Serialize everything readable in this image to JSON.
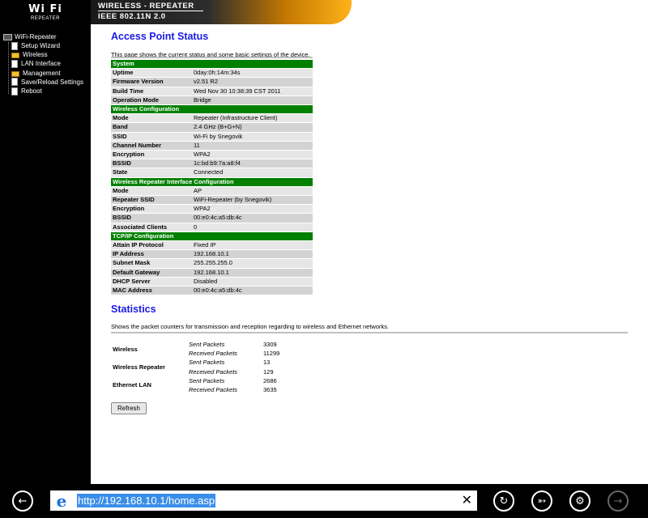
{
  "header": {
    "logo_main": "Wi Fi",
    "logo_sub": "REPEATER",
    "banner_line1": "WIRELESS - REPEATER",
    "banner_line2": "IEEE 802.11N 2.0"
  },
  "sidebar": {
    "root": "WiFi-Repeater",
    "items": [
      {
        "label": "Setup Wizard",
        "icon": "page-icon"
      },
      {
        "label": "Wireless",
        "icon": "folder-icon"
      },
      {
        "label": "LAN Interface",
        "icon": "page-icon"
      },
      {
        "label": "Management",
        "icon": "folder-icon"
      },
      {
        "label": "Save/Reload Settings",
        "icon": "page-icon"
      },
      {
        "label": "Reboot",
        "icon": "page-icon"
      }
    ]
  },
  "main": {
    "title": "Access Point Status",
    "description": "This page shows the current status and some basic settings of the device.",
    "sections": [
      {
        "title": "System",
        "rows": [
          [
            "Uptime",
            "0day:0h:14m:34s"
          ],
          [
            "Firmware Version",
            "v2.51 R2"
          ],
          [
            "Build Time",
            "Wed Nov 30 10:38:39 CST 2011"
          ],
          [
            "Operation Mode",
            "Bridge"
          ]
        ]
      },
      {
        "title": "Wireless Configuration",
        "rows": [
          [
            "Mode",
            "Repeater (Infrastructure Client)"
          ],
          [
            "Band",
            "2.4 GHz (B+G+N)"
          ],
          [
            "SSID",
            "Wi-Fi by Snegovik"
          ],
          [
            "Channel Number",
            "11"
          ],
          [
            "Encryption",
            "WPA2"
          ],
          [
            "BSSID",
            "1c:bd:b9:7a:a8:f4"
          ],
          [
            "State",
            "Connected"
          ]
        ]
      },
      {
        "title": "Wireless Repeater Interface Configuration",
        "rows": [
          [
            "Mode",
            "AP"
          ],
          [
            "Repeater SSID",
            "WiFi-Repeater (by Snegovik)"
          ],
          [
            "Encryption",
            "WPA2"
          ],
          [
            "BSSID",
            "00:e0:4c:a5:db:4c"
          ],
          [
            "Associated Clients",
            "0"
          ]
        ]
      },
      {
        "title": "TCP/IP Configuration",
        "rows": [
          [
            "Attain IP Protocol",
            "Fixed IP"
          ],
          [
            "IP Address",
            "192.168.10.1"
          ],
          [
            "Subnet Mask",
            "255.255.255.0"
          ],
          [
            "Default Gateway",
            "192.168.10.1"
          ],
          [
            "DHCP Server",
            "Disabled"
          ],
          [
            "MAC Address",
            "00:e0:4c:a5:db:4c"
          ]
        ]
      }
    ],
    "stats_title": "Statistics",
    "stats_description": "Shows the packet counters for transmission and reception regarding to wireless and Ethernet networks.",
    "stats": [
      {
        "name": "Wireless",
        "sent_label": "Sent Packets",
        "sent": "3309",
        "recv_label": "Received Packets",
        "recv": "11299"
      },
      {
        "name": "Wireless Repeater",
        "sent_label": "Sent Packets",
        "sent": "13",
        "recv_label": "Received Packets",
        "recv": "129"
      },
      {
        "name": "Ethernet LAN",
        "sent_label": "Sent Packets",
        "sent": "2686",
        "recv_label": "Received Packets",
        "recv": "3635"
      }
    ],
    "refresh_label": "Refresh"
  },
  "browser": {
    "url": "http://192.168.10.1/home.asp",
    "back_icon": "back-arrow-icon",
    "clear_symbol": "✕",
    "buttons": [
      "refresh-icon",
      "pin-icon",
      "tools-icon",
      "forward-arrow-icon"
    ]
  }
}
